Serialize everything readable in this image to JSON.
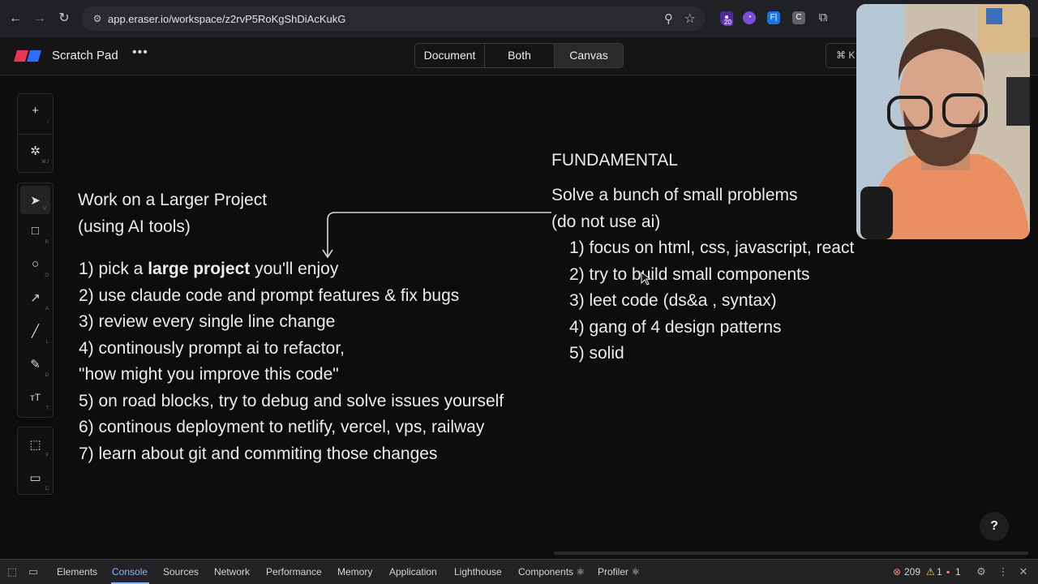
{
  "browser": {
    "url": "app.eraser.io/workspace/z2rvP5RoKgShDiAcKukG",
    "back_icon": "arrow-left-icon",
    "forward_icon": "arrow-right-icon",
    "reload_icon": "reload-icon",
    "ext_badge": "20",
    "ext_f": "F|",
    "ext_c": "C"
  },
  "app": {
    "title": "Scratch Pad",
    "menu": "•••",
    "views": [
      "Document",
      "Both",
      "Canvas"
    ],
    "active_view": "Canvas",
    "shortcut_label": "⌘ K"
  },
  "toolbar": {
    "tools": [
      {
        "name": "add",
        "glyph": "+",
        "hint": "/"
      },
      {
        "name": "ai-sparkle",
        "glyph": "✲",
        "hint": "⌘J"
      },
      {
        "name": "select",
        "glyph": "➤",
        "hint": "V"
      },
      {
        "name": "rectangle",
        "glyph": "□",
        "hint": "R"
      },
      {
        "name": "ellipse",
        "glyph": "○",
        "hint": "O"
      },
      {
        "name": "arrow",
        "glyph": "↗",
        "hint": "A"
      },
      {
        "name": "line",
        "glyph": "╱",
        "hint": "L"
      },
      {
        "name": "pencil",
        "glyph": "✎",
        "hint": "D"
      },
      {
        "name": "text",
        "glyph": "ᴛT",
        "hint": "T"
      },
      {
        "name": "frame",
        "glyph": "⬚",
        "hint": "F"
      },
      {
        "name": "comment",
        "glyph": "▭",
        "hint": "C"
      }
    ]
  },
  "left_note": {
    "title_line1": "Work on a Larger Project",
    "title_line2": "(using AI tools)",
    "item1_pre": "1) pick a ",
    "item1_bold": "large project",
    "item1_post": " you'll enjoy",
    "item2": "2) use claude code and prompt features & fix bugs",
    "item3": "3) review every single line change",
    "item4": "4) continously prompt ai to refactor,",
    "item4b": "\"how might you improve this code\"",
    "item5": "5) on road blocks, try to debug and solve issues yourself",
    "item6": "6) continous deployment to netlify, vercel, vps, railway",
    "item7": "7) learn about git and commiting those changes"
  },
  "right_note": {
    "heading": "FUNDAMENTAL",
    "line1": "Solve a bunch of small problems",
    "line2": "(do not use ai)",
    "items": [
      "1) focus on html, css, javascript, react",
      "2) try to build small components",
      "3) leet code (ds&a , syntax)",
      "4) gang of 4 design patterns",
      "5) solid"
    ]
  },
  "help_label": "?",
  "devtools": {
    "tabs": [
      "Elements",
      "Console",
      "Sources",
      "Network",
      "Performance",
      "Memory",
      "Application",
      "Lighthouse",
      "Components ⚛",
      "Profiler ⚛"
    ],
    "active_tab": "Console",
    "errors": "209",
    "warnings": "1",
    "issues": "1"
  },
  "colors": {
    "canvas_bg": "#0d0d0e",
    "text": "#ececec",
    "accent_blue": "#8ab4f8",
    "logo_red": "#e8384f",
    "logo_blue": "#2f6ff6"
  }
}
